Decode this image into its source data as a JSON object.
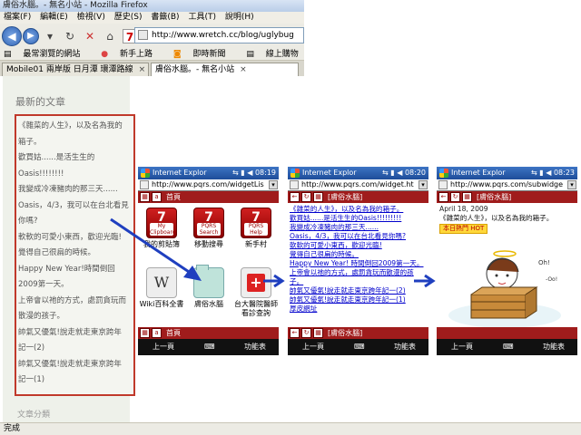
{
  "browser": {
    "window_title": "膚俗水腦。- 無名小站 - Mozilla Firefox",
    "menu": [
      "檔案(F)",
      "編輯(E)",
      "檢視(V)",
      "歷史(S)",
      "書籤(B)",
      "工具(T)",
      "說明(H)"
    ],
    "url": "http://www.wretch.cc/blog/uglybug",
    "bookmarks": [
      "最常瀏覽的網站",
      "新手上路",
      "即時新聞",
      "線上購物"
    ],
    "tabs": [
      {
        "label": "Mobile01 兩岸版 日月潭 環潭路線"
      },
      {
        "label": "膚俗水腦。- 無名小站"
      }
    ],
    "status": "完成"
  },
  "page": {
    "sidebar_title": "最新的文章",
    "articles": [
      "《雜菜的人生》，以及名為我的",
      "箱子。",
      "歡買姑......是活生生的",
      "Oasis!!!!!!!!",
      "我變成冷凍豬肉的那三天......",
      "Oasis，4/3，我可以在台北看見",
      "你嗎?",
      "軟軟的可愛小東西，歡迎光臨!",
      "覺得自己很扁的時候。",
      "Happy New Year!時間倒回",
      "2009第一天。",
      "上帝會以祂的方式，處罰貪玩而",
      "散漫的孩子。",
      "帥氣又優氣!說走就走東京跨年",
      "記一(2)",
      "帥氣又優氣!說走就走東京跨年",
      "記一(1)"
    ],
    "next_section": "文章分類"
  },
  "phones": [
    {
      "app": "Internet Explor",
      "time": "08:19",
      "url": "http://www.pqrs.com/widgetLis",
      "toolbar_label": "首頁",
      "apps": [
        {
          "icon": "7",
          "sub": "My Clipboard",
          "label": "我的剪貼簿"
        },
        {
          "icon": "7",
          "sub": "PQRS Search",
          "label": "移動搜尋"
        },
        {
          "icon": "7",
          "sub": "PQRS Help",
          "label": "新手村"
        },
        {
          "icon": "W",
          "sub": "",
          "label": "Wiki百科全書"
        },
        {
          "icon": "",
          "sub": "",
          "label": "膚俗水腦"
        },
        {
          "icon": "",
          "sub": "",
          "label": "台大醫院醫師看診查詢"
        }
      ],
      "bottom_label": "首頁",
      "soft": {
        "left": "上一頁",
        "right": "功能表"
      }
    },
    {
      "app": "Internet Explor",
      "time": "08:20",
      "url": "http://www.pqrs.com/widget.ht",
      "toolbar_label": "[膚俗水腦]",
      "links": [
        "《雜菜的人生》，以及名為我的箱子。",
        "歡買姑......是活生生的Oasis!!!!!!!!!",
        "我變成冷凍豬肉的那三天......",
        "Oasis，4/3，我可以在台北看見你嗎?",
        "軟軟的可愛小東西，歡迎光臨!",
        "覺得自己很扁的時候。",
        "Happy New Year! 時間倒回2009第一天。",
        "上帝會以祂的方式，處罰貪玩而散漫的孩",
        "子。",
        "帥氣又優氣!說走就走東京跨年記一(2)",
        "帥氣又優氣!說走就走東京跨年記一(1)",
        "厚皮網址"
      ],
      "bottom_label": "[膚俗水腦]",
      "soft": {
        "left": "上一頁",
        "right": "功能表"
      }
    },
    {
      "app": "Internet Explor",
      "time": "08:23",
      "url": "http://www.pqrs.com/subwidge",
      "toolbar_label": "[膚俗水腦]",
      "date": "April 18, 2009",
      "post_title": "《雜菜的人生》，以及名為我的箱子。",
      "badge": "本日熱門 HOT",
      "bottom_label": "",
      "soft": {
        "left": "上一頁",
        "right": "功能表"
      }
    }
  ],
  "colors": {
    "accent": "#a01c1c",
    "arrow": "#1f3fbf"
  }
}
